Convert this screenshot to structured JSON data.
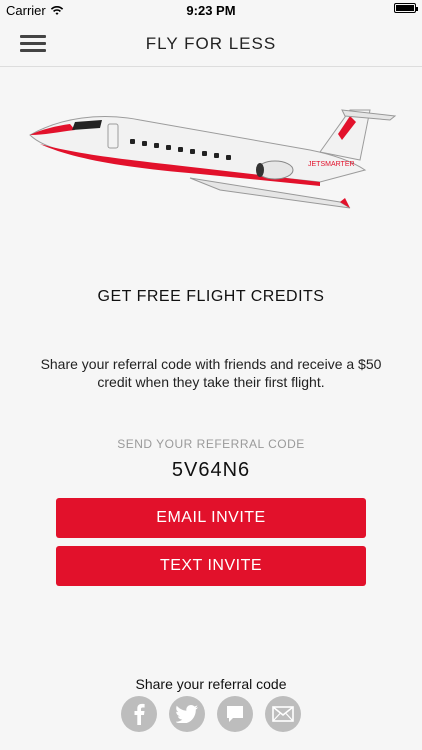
{
  "status_bar": {
    "carrier": "Carrier",
    "time": "9:23 PM"
  },
  "nav": {
    "title": "FLY FOR LESS",
    "menu_icon": "hamburger-menu-icon"
  },
  "hero": {
    "image": "private-jet-illustration",
    "tail_text": "JETSMARTER",
    "colors": {
      "accent": "#e2112b",
      "body": "#f2f2f2"
    }
  },
  "headline": "GET FREE FLIGHT CREDITS",
  "description": "Share your referral code with friends and receive a $50 credit when they take their first flight.",
  "referral": {
    "label": "SEND YOUR REFERRAL CODE",
    "code": "5V64N6"
  },
  "buttons": {
    "email": "EMAIL INVITE",
    "text": "TEXT INVITE"
  },
  "share": {
    "label": "Share your referral code",
    "icons": [
      "facebook-icon",
      "twitter-icon",
      "message-icon",
      "mail-icon"
    ]
  },
  "theme": {
    "accent": "#e2112b",
    "background": "#f6f6f6",
    "muted": "#9a9a9a",
    "icon_circle": "#bdbdbd"
  }
}
